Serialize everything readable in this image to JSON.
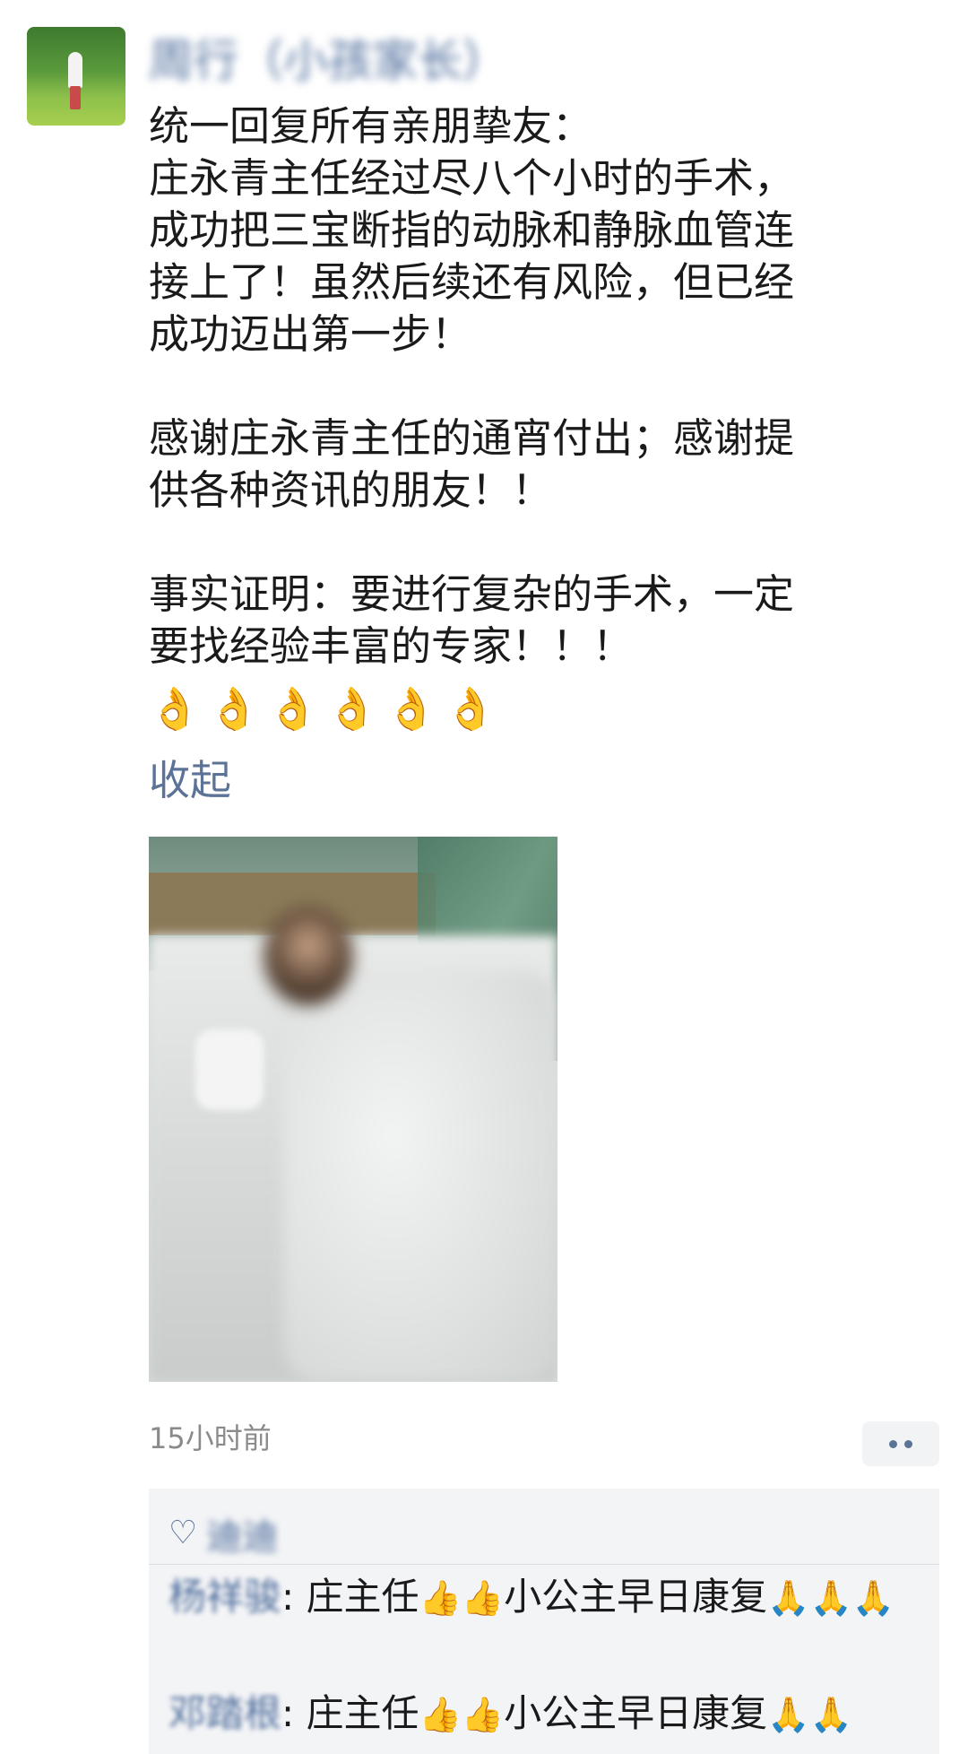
{
  "post": {
    "username": "周行（小孩家长）",
    "text": "统一回复所有亲朋挚友：\n庄永青主任经过尽八个小时的手术，\n成功把三宝断指的动脉和静脉血管连\n接上了！虽然后续还有风险，但已经\n成功迈出第一步！\n\n感谢庄永青主任的通宵付出；感谢提\n供各种资讯的朋友！！\n\n事实证明：要进行复杂的手术，一定\n要找经验丰富的专家！！！",
    "emoji": [
      "👌",
      "👌",
      "👌",
      "👌",
      "👌",
      "👌"
    ],
    "collapse_label": "收起",
    "timestamp": "15小时前"
  },
  "interactions": {
    "likes": [
      "迪迪"
    ],
    "comments": [
      {
        "author": "杨祥骏",
        "separator": ":",
        "text_before": " 庄主任",
        "emoji_mid": "👍👍",
        "text_after": "小公主早日康复",
        "emoji_end": "🙏🙏🙏"
      },
      {
        "author": "邓踏根",
        "separator": ":",
        "text_before": " 庄主任",
        "emoji_mid": "👍👍",
        "text_after": "小公主早日康复",
        "emoji_end": "🙏🙏"
      }
    ]
  },
  "colors": {
    "link": "#5b7397",
    "username": "#4e6d9c",
    "panel_bg": "#f3f4f6",
    "timestamp": "#8a8a8a"
  }
}
